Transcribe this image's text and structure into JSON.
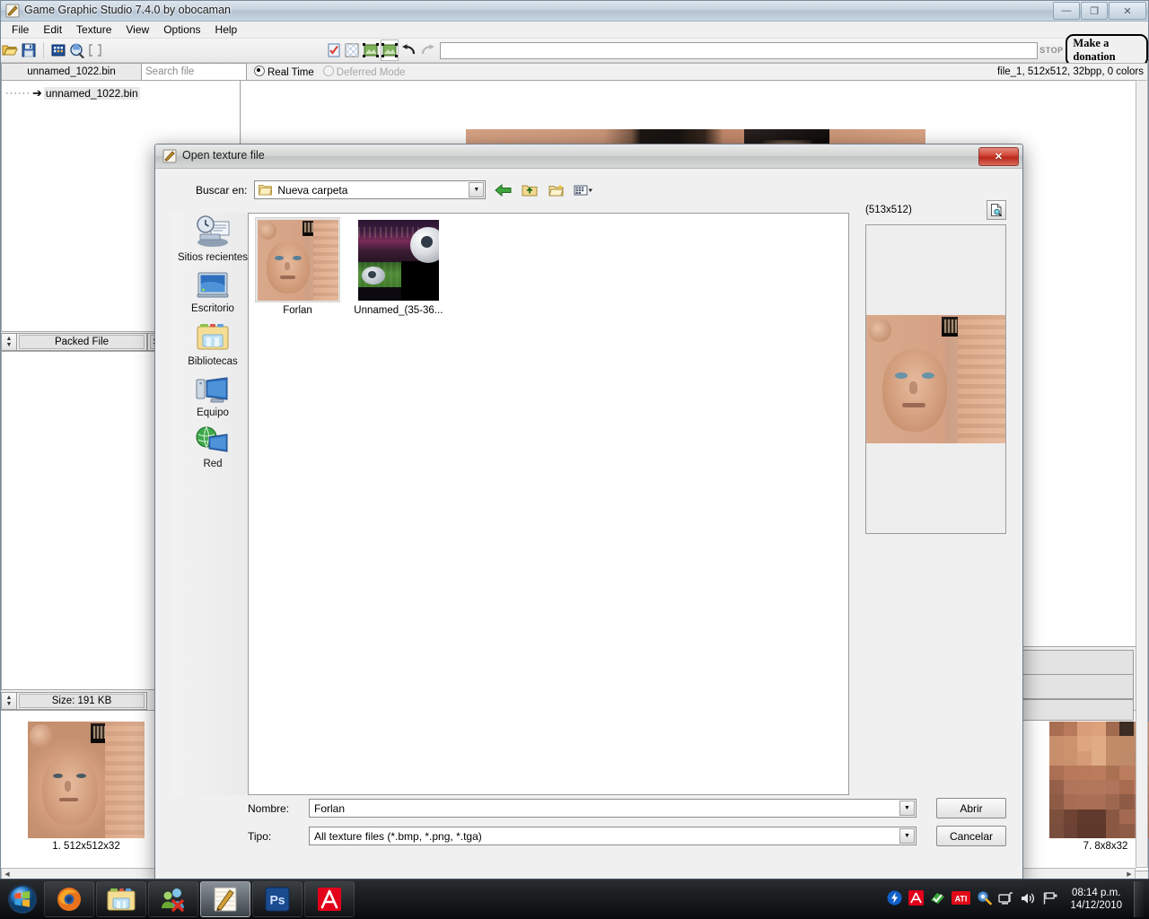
{
  "app": {
    "title": "Game Graphic Studio 7.4.0 by obocaman",
    "icon": "pencil-ruler-icon",
    "window_buttons": {
      "minimize": "—",
      "restore": "❐",
      "close": "✕"
    },
    "menu": [
      "File",
      "Edit",
      "Texture",
      "View",
      "Options",
      "Help"
    ],
    "toolbar": {
      "icons": [
        "open-folder-icon",
        "save-icon",
        "palette-icon",
        "search-texture-icon",
        "brackets-icon",
        "checklist-icon",
        "transparency-grid-icon",
        "image-select-icon",
        "image-active-icon",
        "undo-icon",
        "redo-icon"
      ],
      "url_value": "",
      "stop_label": "STOP",
      "donation_label": "Make a donation"
    },
    "tab_label": "unnamed_1022.bin",
    "search_placeholder": "Search file",
    "mode": {
      "realtime_label": "Real Time",
      "realtime_selected": true,
      "deferred_label": "Deferred Mode",
      "deferred_enabled": false
    },
    "file_info": "file_1, 512x512, 32bpp, 0 colors",
    "tree": {
      "dots": "······",
      "arrow": "➔",
      "item": "unnamed_1022.bin"
    },
    "packed_file_header": "Packed File",
    "size_header": "Size: 191 KB",
    "thumb_left_caption": "1. 512x512x32",
    "thumb_right_caption": "7. 8x8x32"
  },
  "dialog": {
    "title": "Open texture file",
    "icon": "pencil-ruler-icon",
    "close_label": "✕",
    "lookin_label": "Buscar en:",
    "lookin_value": "Nueva carpeta",
    "nav_icons": [
      "back-arrow-icon",
      "up-folder-icon",
      "new-folder-icon",
      "views-dropdown-icon"
    ],
    "places": [
      {
        "label": "Sitios recientes",
        "icon": "recent-places-icon"
      },
      {
        "label": "Escritorio",
        "icon": "desktop-icon"
      },
      {
        "label": "Bibliotecas",
        "icon": "libraries-folder-icon"
      },
      {
        "label": "Equipo",
        "icon": "computer-icon"
      },
      {
        "label": "Red",
        "icon": "network-globe-icon"
      }
    ],
    "files": [
      {
        "name": "Forlan",
        "selected": true,
        "kind": "face-texture-thumbnail"
      },
      {
        "name": "Unnamed_(35-36...",
        "selected": false,
        "kind": "stadium-ball-thumbnail"
      }
    ],
    "preview": {
      "size_label": "(513x512)",
      "button_icon": "preview-zoom-icon"
    },
    "name_label": "Nombre:",
    "name_value": "Forlan",
    "type_label": "Tipo:",
    "type_value": "All texture files (*.bmp, *.png, *.tga)",
    "open_button": "Abrir",
    "cancel_button": "Cancelar"
  },
  "taskbar": {
    "start_icon": "windows-start-orb-icon",
    "items": [
      {
        "icon": "firefox-icon",
        "active": false
      },
      {
        "icon": "windows-explorer-icon",
        "active": false
      },
      {
        "icon": "messenger-icon",
        "active": false
      },
      {
        "icon": "game-graphic-studio-icon",
        "active": true
      },
      {
        "icon": "photoshop-icon",
        "active": false
      },
      {
        "icon": "avira-icon",
        "active": false
      }
    ],
    "tray_icons": [
      "flash-icon",
      "avira-tray-icon",
      "green-check-icon",
      "ati-icon",
      "settings-icon",
      "network-icon",
      "volume-icon",
      "flag-action-center-icon"
    ],
    "time": "08:14 p.m.",
    "date": "14/12/2010"
  },
  "colors": {
    "accent_blue": "#3b6ea5",
    "dialog_close_red": "#cf4234",
    "selected_item": "#e6e6e6",
    "skin_tone": "#d7a183"
  }
}
